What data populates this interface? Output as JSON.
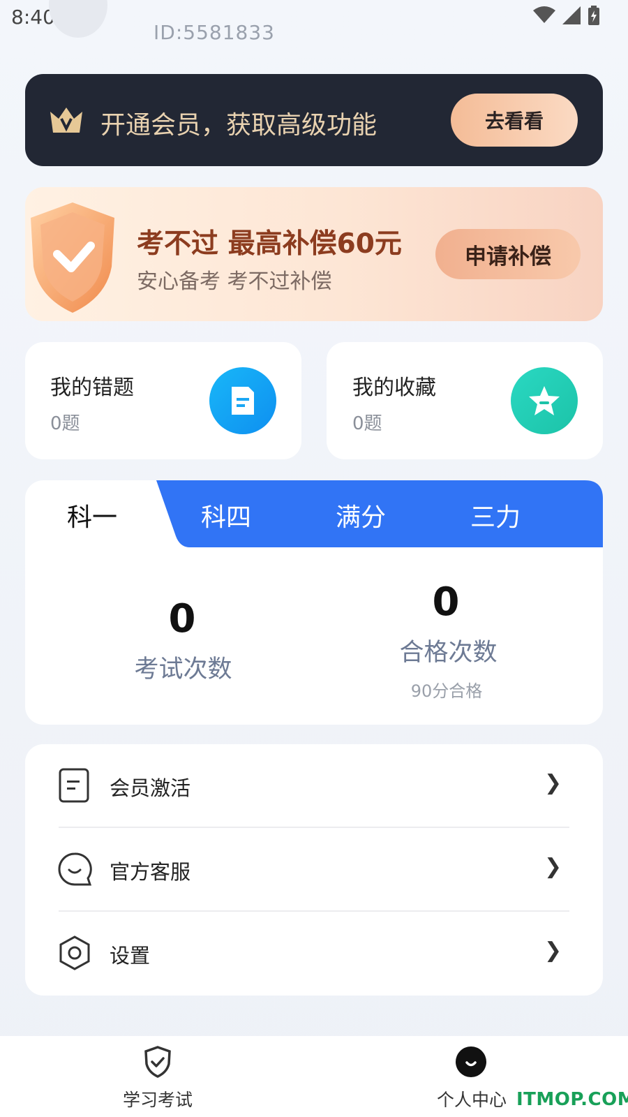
{
  "status": {
    "time": "8:40"
  },
  "profile": {
    "user_id": "ID:5581833"
  },
  "vip_banner": {
    "text": "开通会员，获取高级功能",
    "button": "去看看"
  },
  "compensation": {
    "title": "考不过 最高补偿60元",
    "subtitle": "安心备考 考不过补偿",
    "button": "申请补偿"
  },
  "quick_cards": [
    {
      "title": "我的错题",
      "count": "0题",
      "icon": "document-icon",
      "color": "#1aa6f4"
    },
    {
      "title": "我的收藏",
      "count": "0题",
      "icon": "star-icon",
      "color": "#21d0b8"
    }
  ],
  "tabs": [
    {
      "label": "科一",
      "active": true
    },
    {
      "label": "科四",
      "active": false
    },
    {
      "label": "满分",
      "active": false
    },
    {
      "label": "三力",
      "active": false
    }
  ],
  "stats": {
    "exam_count": {
      "value": "0",
      "label": "考试次数"
    },
    "pass_count": {
      "value": "0",
      "label": "合格次数",
      "note": "90分合格"
    }
  },
  "menu": [
    {
      "label": "会员激活",
      "icon": "document-outline-icon"
    },
    {
      "label": "官方客服",
      "icon": "chat-bubble-icon"
    },
    {
      "label": "设置",
      "icon": "hexagon-settings-icon"
    }
  ],
  "bottom_nav": [
    {
      "label": "学习考试",
      "icon": "shield-check-icon",
      "active": false
    },
    {
      "label": "个人中心",
      "icon": "smile-face-icon",
      "active": true
    }
  ],
  "watermark": "ITMOP.COM",
  "colors": {
    "tab_blue": "#3174f5",
    "vip_dark": "#222734",
    "accent_gold": "#e9d2b0"
  }
}
